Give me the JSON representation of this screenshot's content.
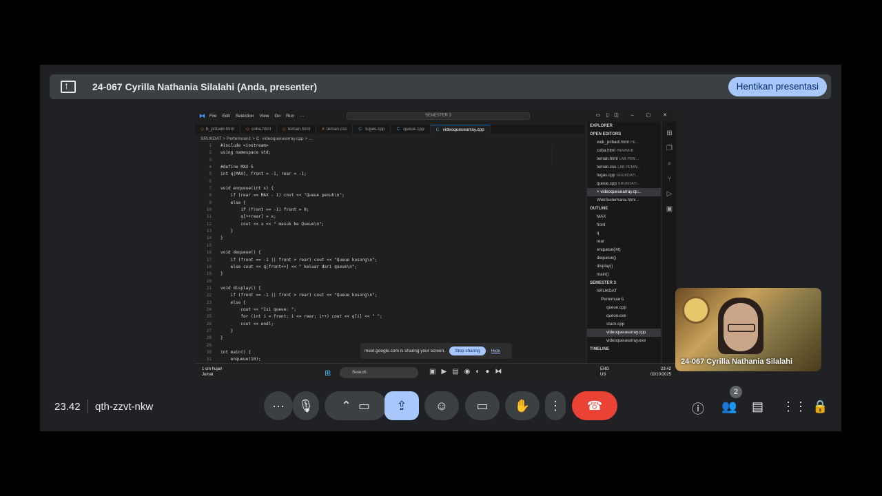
{
  "presenter_bar": {
    "title": "24-067 Cyrilla Nathania Silalahi (Anda, presenter)",
    "stop_label": "Hentikan presentasi"
  },
  "vscode": {
    "menus": [
      "File",
      "Edit",
      "Selection",
      "View",
      "Go",
      "Run",
      "···"
    ],
    "search": "SEMESTER 3",
    "tabs": [
      {
        "label": "b_pribadi.html",
        "type": "html"
      },
      {
        "label": "coba.html",
        "type": "html"
      },
      {
        "label": "teman.html",
        "type": "html"
      },
      {
        "label": "teman.css",
        "type": "css"
      },
      {
        "label": "tugas.cpp",
        "type": "cpp"
      },
      {
        "label": "queue.cpp",
        "type": "cpp"
      },
      {
        "label": "videoqueuearray.cpp",
        "type": "cpp",
        "active": true
      }
    ],
    "breadcrumb": "SRUKDAT > Pertemuan1 > C· videoqueuearray.cpp > ...",
    "code_lines": [
      {
        "n": "1",
        "t": "#include <iostream>"
      },
      {
        "n": "2",
        "t": "using namespace std;"
      },
      {
        "n": "3",
        "t": ""
      },
      {
        "n": "4",
        "t": "#define MAX 5"
      },
      {
        "n": "5",
        "t": "int q[MAX], front = -1, rear = -1;"
      },
      {
        "n": "6",
        "t": ""
      },
      {
        "n": "7",
        "t": "void enqueue(int x) {"
      },
      {
        "n": "8",
        "t": "    if (rear == MAX - 1) cout << \"Queue penuh\\n\";"
      },
      {
        "n": "9",
        "t": "    else {"
      },
      {
        "n": "10",
        "t": "        if (front == -1) front = 0;"
      },
      {
        "n": "11",
        "t": "        q[++rear] = x;"
      },
      {
        "n": "12",
        "t": "        cout << x << \" masuk ke Queue\\n\";"
      },
      {
        "n": "13",
        "t": "    }"
      },
      {
        "n": "14",
        "t": "}"
      },
      {
        "n": "15",
        "t": ""
      },
      {
        "n": "16",
        "t": "void dequeue() {"
      },
      {
        "n": "17",
        "t": "    if (front == -1 || front > rear) cout << \"Queue kosong\\n\";"
      },
      {
        "n": "18",
        "t": "    else cout << q[front++] << \" keluar dari queue\\n\";"
      },
      {
        "n": "19",
        "t": "}"
      },
      {
        "n": "20",
        "t": ""
      },
      {
        "n": "21",
        "t": "void display() {"
      },
      {
        "n": "22",
        "t": "    if (front == -1 || front > rear) cout << \"Queue kosong\\n\";"
      },
      {
        "n": "23",
        "t": "    else {"
      },
      {
        "n": "24",
        "t": "        cout << \"Isi queue: \";"
      },
      {
        "n": "25",
        "t": "        for (int i = front; i <= rear; i++) cout << q[i] << \" \";"
      },
      {
        "n": "26",
        "t": "        cout << endl;"
      },
      {
        "n": "27",
        "t": "    }"
      },
      {
        "n": "28",
        "t": "}"
      },
      {
        "n": "29",
        "t": ""
      },
      {
        "n": "30",
        "t": "int main() {"
      },
      {
        "n": "31",
        "t": "    enqueue(10);"
      }
    ],
    "explorer": {
      "title": "EXPLORER",
      "open_editors_title": "OPEN EDITORS",
      "open_editors": [
        {
          "name": "web_pribadi.html",
          "sub": "PE..."
        },
        {
          "name": "coba.html",
          "sub": "PEMWEB"
        },
        {
          "name": "teman.html",
          "sub": "LAB PEM..."
        },
        {
          "name": "teman.css",
          "sub": "LAB PEMW..."
        },
        {
          "name": "tugas.cpp",
          "sub": "SRUKDAT\\..."
        },
        {
          "name": "queue.cpp",
          "sub": "SRUKDAT\\..."
        },
        {
          "name": "× videoqueuearray.cp...",
          "sub": "",
          "selected": true
        },
        {
          "name": "WebSederhana.html...",
          "sub": ""
        }
      ],
      "outline_title": "OUTLINE",
      "outline": [
        "MAX",
        "front",
        "q",
        "rear",
        "enqueue(int)",
        "dequeue()",
        "display()",
        "main()"
      ],
      "folder_title": "SEMESTER 3",
      "folders": [
        "SRUKDAT",
        "Pertemuan1"
      ],
      "files": [
        {
          "name": "queue.cpp",
          "selected": false
        },
        {
          "name": "queue.exe",
          "selected": false
        },
        {
          "name": "stack.cpp",
          "selected": false
        },
        {
          "name": "videoqueuearray.cpp",
          "selected": true
        },
        {
          "name": "videoqueuearray.exe",
          "selected": false
        }
      ],
      "timeline_title": "TIMELINE"
    },
    "share_popup": {
      "text": "meet.google.com is sharing your screen.",
      "stop": "Stop sharing",
      "hide": "Hide"
    }
  },
  "taskbar": {
    "weather_temp": "1 cm hujan",
    "weather_day": "Jumat",
    "search": "Search",
    "lang1": "ENG",
    "lang2": "US",
    "time": "23:42",
    "date": "02/10/2025"
  },
  "camera_tile": {
    "name": "24-067 Cyrilla Nathania Silalahi"
  },
  "bottom_bar": {
    "time": "23.42",
    "meeting_code": "qth-zzvt-nkw",
    "participants_count": "2"
  }
}
